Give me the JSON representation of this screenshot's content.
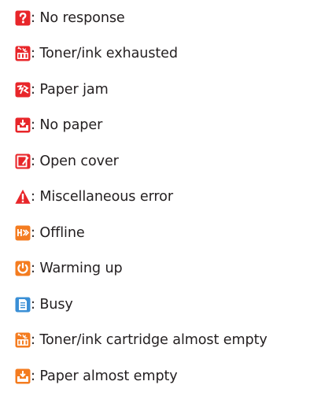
{
  "separator": ": ",
  "items": [
    {
      "icon": "question-mark-icon",
      "label": "No response"
    },
    {
      "icon": "toner-exhausted-icon",
      "label": "Toner/ink exhausted"
    },
    {
      "icon": "paper-jam-icon",
      "label": "Paper jam"
    },
    {
      "icon": "no-paper-icon",
      "label": "No paper"
    },
    {
      "icon": "open-cover-icon",
      "label": "Open cover"
    },
    {
      "icon": "warning-triangle-icon",
      "label": "Miscellaneous error"
    },
    {
      "icon": "offline-icon",
      "label": "Offline"
    },
    {
      "icon": "power-icon",
      "label": "Warming up"
    },
    {
      "icon": "busy-document-icon",
      "label": "Busy"
    },
    {
      "icon": "toner-low-icon",
      "label": "Toner/ink cartridge almost empty"
    },
    {
      "icon": "paper-low-icon",
      "label": "Paper almost empty"
    }
  ],
  "colors": {
    "error_red": "#e8262a",
    "warning_orange": "#f47c20",
    "busy_blue": "#3a8fd6",
    "text": "#231f20"
  }
}
